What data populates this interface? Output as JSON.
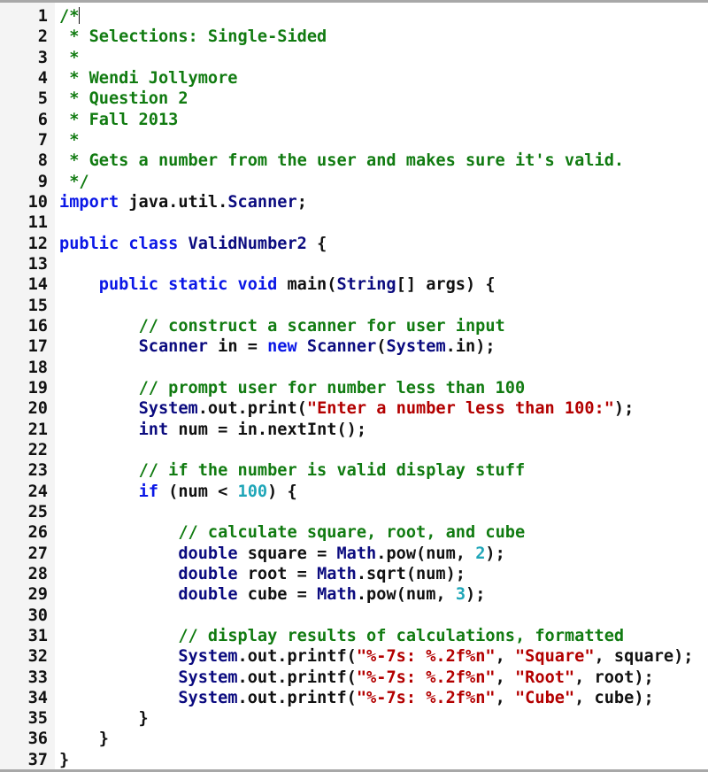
{
  "editor": {
    "language": "java",
    "cursor_line": 1,
    "lines": [
      {
        "n": "1",
        "tokens": [
          [
            "c",
            "/*"
          ]
        ]
      },
      {
        "n": "2",
        "tokens": [
          [
            "c",
            " * Selections: Single-Sided"
          ]
        ]
      },
      {
        "n": "3",
        "tokens": [
          [
            "c",
            " *"
          ]
        ]
      },
      {
        "n": "4",
        "tokens": [
          [
            "c",
            " * Wendi Jollymore"
          ]
        ]
      },
      {
        "n": "5",
        "tokens": [
          [
            "c",
            " * Question 2"
          ]
        ]
      },
      {
        "n": "6",
        "tokens": [
          [
            "c",
            " * Fall 2013"
          ]
        ]
      },
      {
        "n": "7",
        "tokens": [
          [
            "c",
            " *"
          ]
        ]
      },
      {
        "n": "8",
        "tokens": [
          [
            "c",
            " * Gets a number from the user and makes sure it's valid."
          ]
        ]
      },
      {
        "n": "9",
        "tokens": [
          [
            "c",
            " */"
          ]
        ]
      },
      {
        "n": "10",
        "tokens": [
          [
            "k",
            "import"
          ],
          [
            "p",
            " java.util."
          ],
          [
            "t",
            "Scanner"
          ],
          [
            "p",
            ";"
          ]
        ]
      },
      {
        "n": "11",
        "tokens": []
      },
      {
        "n": "12",
        "tokens": [
          [
            "k",
            "public class "
          ],
          [
            "t",
            "ValidNumber2"
          ],
          [
            "p",
            " {"
          ]
        ]
      },
      {
        "n": "13",
        "tokens": []
      },
      {
        "n": "14",
        "tokens": [
          [
            "p",
            "    "
          ],
          [
            "k",
            "public static void"
          ],
          [
            "p",
            " main("
          ],
          [
            "t",
            "String"
          ],
          [
            "p",
            "[] args) {"
          ]
        ]
      },
      {
        "n": "15",
        "tokens": []
      },
      {
        "n": "16",
        "tokens": [
          [
            "p",
            "        "
          ],
          [
            "c",
            "// construct a scanner for user input"
          ]
        ]
      },
      {
        "n": "17",
        "tokens": [
          [
            "p",
            "        "
          ],
          [
            "t",
            "Scanner"
          ],
          [
            "p",
            " in = "
          ],
          [
            "k",
            "new"
          ],
          [
            "p",
            " "
          ],
          [
            "t",
            "Scanner"
          ],
          [
            "p",
            "("
          ],
          [
            "t",
            "System"
          ],
          [
            "p",
            ".in);"
          ]
        ]
      },
      {
        "n": "18",
        "tokens": []
      },
      {
        "n": "19",
        "tokens": [
          [
            "p",
            "        "
          ],
          [
            "c",
            "// prompt user for number less than 100"
          ]
        ]
      },
      {
        "n": "20",
        "tokens": [
          [
            "p",
            "        "
          ],
          [
            "t",
            "System"
          ],
          [
            "p",
            ".out.print("
          ],
          [
            "s",
            "\"Enter a number less than 100:\""
          ],
          [
            "p",
            ");"
          ]
        ]
      },
      {
        "n": "21",
        "tokens": [
          [
            "p",
            "        "
          ],
          [
            "t",
            "int"
          ],
          [
            "p",
            " num = in.nextInt();"
          ]
        ]
      },
      {
        "n": "22",
        "tokens": []
      },
      {
        "n": "23",
        "tokens": [
          [
            "p",
            "        "
          ],
          [
            "c",
            "// if the number is valid display stuff"
          ]
        ]
      },
      {
        "n": "24",
        "tokens": [
          [
            "p",
            "        "
          ],
          [
            "k",
            "if"
          ],
          [
            "p",
            " (num < "
          ],
          [
            "n",
            "100"
          ],
          [
            "p",
            ") {"
          ]
        ]
      },
      {
        "n": "25",
        "tokens": []
      },
      {
        "n": "26",
        "tokens": [
          [
            "p",
            "            "
          ],
          [
            "c",
            "// calculate square, root, and cube"
          ]
        ]
      },
      {
        "n": "27",
        "tokens": [
          [
            "p",
            "            "
          ],
          [
            "t",
            "double"
          ],
          [
            "p",
            " square = "
          ],
          [
            "t",
            "Math"
          ],
          [
            "p",
            ".pow(num, "
          ],
          [
            "n",
            "2"
          ],
          [
            "p",
            ");"
          ]
        ]
      },
      {
        "n": "28",
        "tokens": [
          [
            "p",
            "            "
          ],
          [
            "t",
            "double"
          ],
          [
            "p",
            " root = "
          ],
          [
            "t",
            "Math"
          ],
          [
            "p",
            ".sqrt(num);"
          ]
        ]
      },
      {
        "n": "29",
        "tokens": [
          [
            "p",
            "            "
          ],
          [
            "t",
            "double"
          ],
          [
            "p",
            " cube = "
          ],
          [
            "t",
            "Math"
          ],
          [
            "p",
            ".pow(num, "
          ],
          [
            "n",
            "3"
          ],
          [
            "p",
            ");"
          ]
        ]
      },
      {
        "n": "30",
        "tokens": []
      },
      {
        "n": "31",
        "tokens": [
          [
            "p",
            "            "
          ],
          [
            "c",
            "// display results of calculations, formatted"
          ]
        ]
      },
      {
        "n": "32",
        "tokens": [
          [
            "p",
            "            "
          ],
          [
            "t",
            "System"
          ],
          [
            "p",
            ".out.printf("
          ],
          [
            "s",
            "\"%-7s: %.2f%n\""
          ],
          [
            "p",
            ", "
          ],
          [
            "s",
            "\"Square\""
          ],
          [
            "p",
            ", square);"
          ]
        ]
      },
      {
        "n": "33",
        "tokens": [
          [
            "p",
            "            "
          ],
          [
            "t",
            "System"
          ],
          [
            "p",
            ".out.printf("
          ],
          [
            "s",
            "\"%-7s: %.2f%n\""
          ],
          [
            "p",
            ", "
          ],
          [
            "s",
            "\"Root\""
          ],
          [
            "p",
            ", root);"
          ]
        ]
      },
      {
        "n": "34",
        "tokens": [
          [
            "p",
            "            "
          ],
          [
            "t",
            "System"
          ],
          [
            "p",
            ".out.printf("
          ],
          [
            "s",
            "\"%-7s: %.2f%n\""
          ],
          [
            "p",
            ", "
          ],
          [
            "s",
            "\"Cube\""
          ],
          [
            "p",
            ", cube);"
          ]
        ]
      },
      {
        "n": "35",
        "tokens": [
          [
            "p",
            "        }"
          ]
        ]
      },
      {
        "n": "36",
        "tokens": [
          [
            "p",
            "    }"
          ]
        ]
      },
      {
        "n": "37",
        "tokens": [
          [
            "p",
            "}"
          ]
        ]
      }
    ]
  },
  "colors": {
    "comment": "#117b11",
    "keyword": "#0a17e6",
    "type": "#0b0b7f",
    "string": "#b30000",
    "number": "#1fa6b8",
    "plain": "#111111"
  }
}
